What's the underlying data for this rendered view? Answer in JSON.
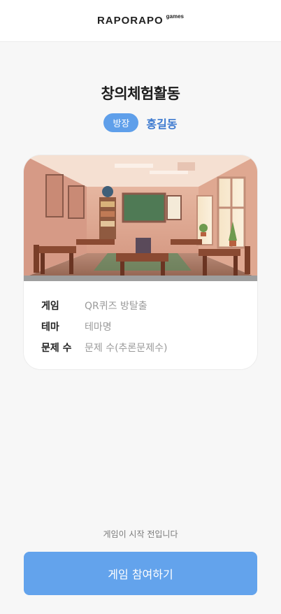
{
  "header": {
    "logo_text": "RAPORAPO",
    "logo_sub": "games"
  },
  "room": {
    "title": "창의체험활동",
    "host_badge": "방장",
    "host_name": "홍길동"
  },
  "card": {
    "image": "classroom-illustration",
    "info": [
      {
        "label": "게임",
        "value": "QR퀴즈 방탈출"
      },
      {
        "label": "테마",
        "value": "테마명"
      },
      {
        "label": "문제 수",
        "value": "문제 수(추론문제수)"
      }
    ]
  },
  "footer": {
    "status_text": "게임이 시작 전입니다",
    "join_label": "게임 참여하기"
  },
  "colors": {
    "accent": "#63a3ec",
    "host_name": "#3d7ad0",
    "background": "#f7f7f7"
  }
}
